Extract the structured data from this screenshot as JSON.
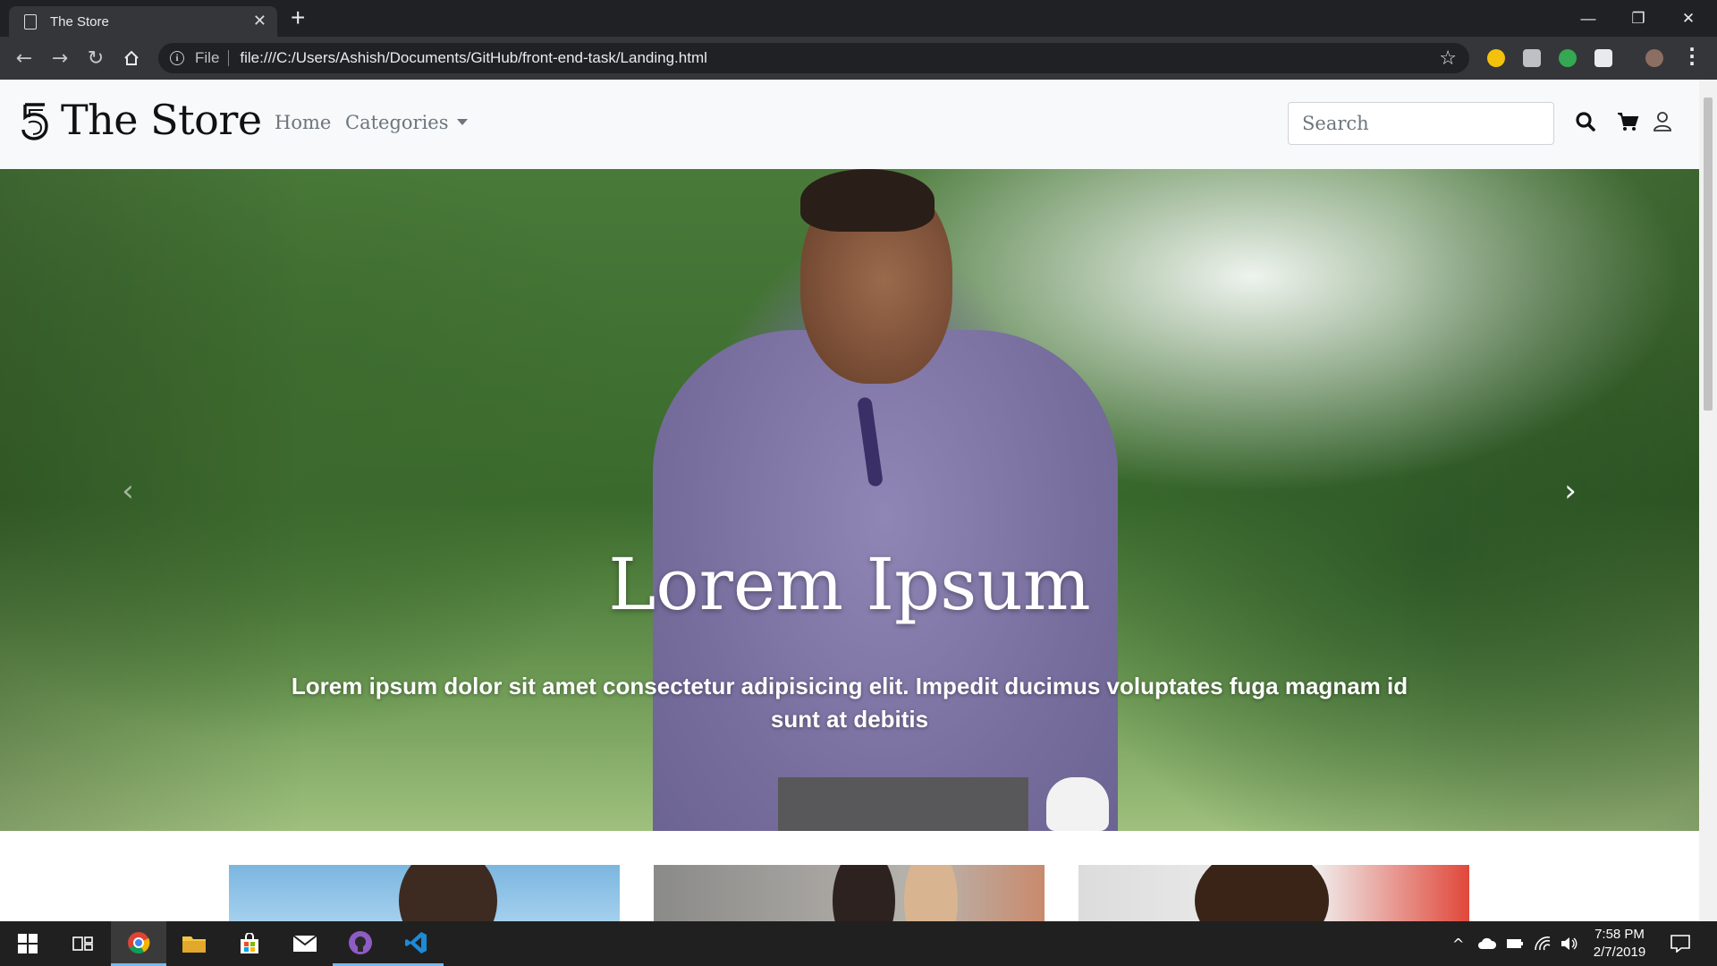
{
  "browser": {
    "tab_title": "The Store",
    "tab_close": "✕",
    "new_tab": "+",
    "window_controls": {
      "minimize": "—",
      "restore": "❐",
      "close": "✕"
    },
    "address": {
      "scheme_label": "File",
      "url": "file:///C:/Users/Ashish/Documents/GitHub/front-end-task/Landing.html"
    },
    "icons": [
      "back-icon",
      "forward-icon",
      "reload-icon",
      "home-icon",
      "info-icon",
      "bookmark-star-icon",
      "menu-icon"
    ],
    "extension_colors": [
      "#f4c20d",
      "#bdc1c6",
      "#34a853",
      "#e8eaed"
    ]
  },
  "site": {
    "brand": "The Store",
    "nav": {
      "home": "Home",
      "categories": "Categories"
    },
    "search": {
      "placeholder": "Search"
    },
    "icons": [
      "search-icon",
      "cart-icon",
      "user-icon"
    ]
  },
  "hero": {
    "title": "Lorem Ipsum",
    "text": "Lorem ipsum dolor sit amet consectetur adipisicing elit. Impedit ducimus voluptates fuga magnam id sunt at debitis",
    "prev": "‹",
    "next": "›"
  },
  "taskbar": {
    "apps": [
      "windows-start-icon",
      "task-view-icon",
      "chrome-icon",
      "file-explorer-icon",
      "store-icon",
      "mail-icon",
      "github-desktop-icon",
      "vscode-icon"
    ],
    "tray": {
      "chevron": "^"
    },
    "clock": {
      "time": "7:58 PM",
      "date": "2/7/2019"
    }
  }
}
